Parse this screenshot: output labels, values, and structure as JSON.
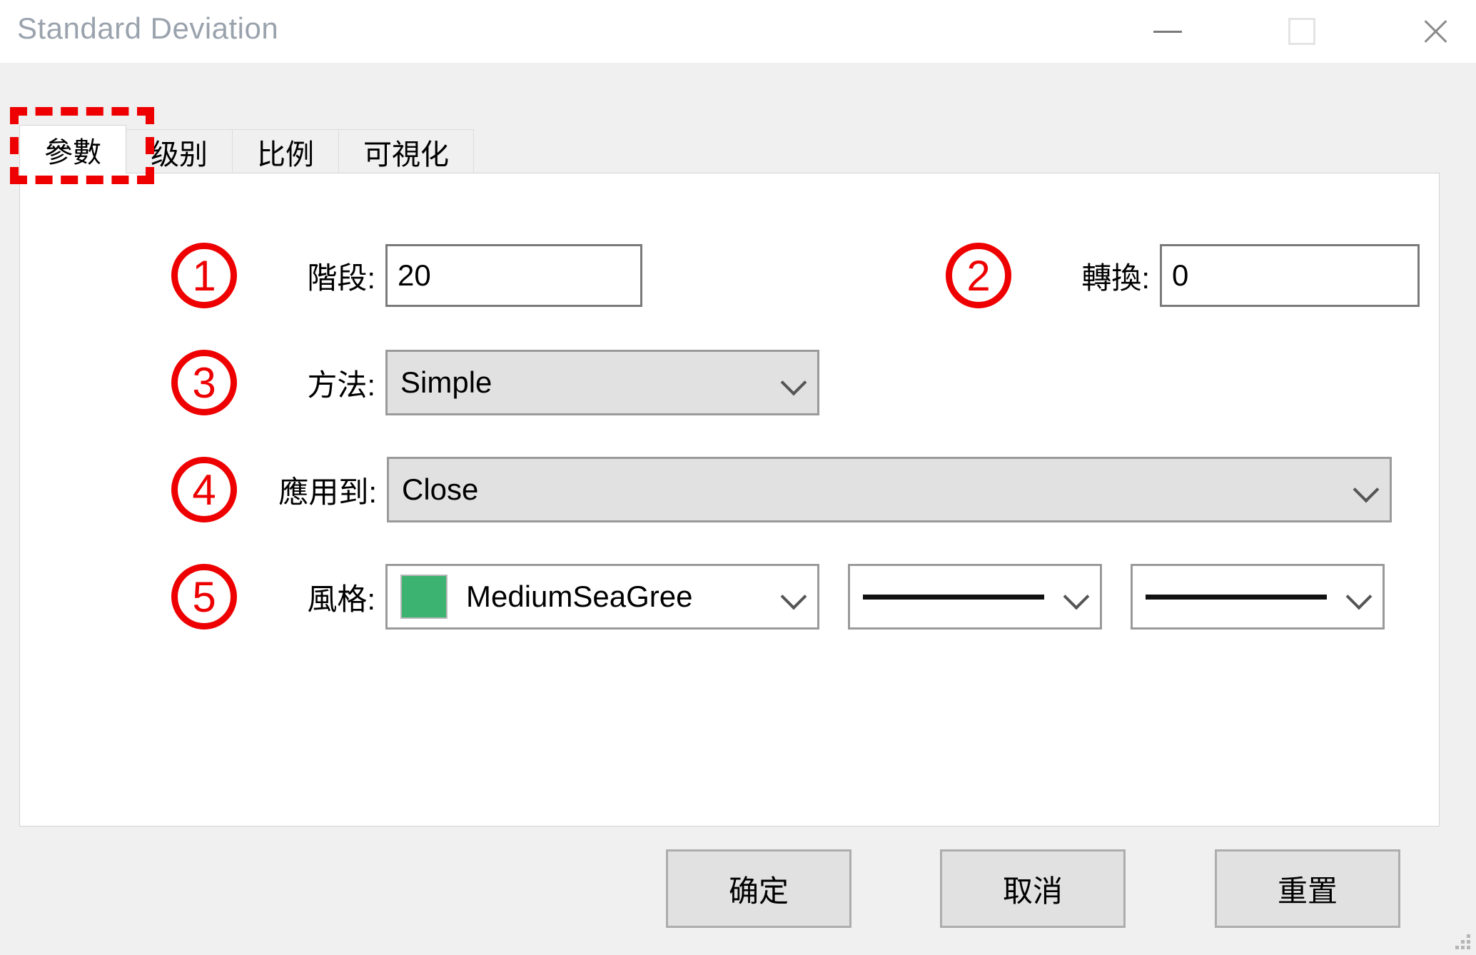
{
  "window": {
    "title": "Standard Deviation",
    "controls": {
      "minimize": "minimize-icon",
      "maximize": "maximize-icon",
      "close": "close-icon"
    }
  },
  "tabs": [
    {
      "label": "參數",
      "active": true
    },
    {
      "label": "级别",
      "active": false
    },
    {
      "label": "比例",
      "active": false
    },
    {
      "label": "可視化",
      "active": false
    }
  ],
  "annotations": {
    "markers": [
      "1",
      "2",
      "3",
      "4",
      "5"
    ],
    "highlight_color": "#EE0000"
  },
  "form": {
    "period": {
      "marker": "1",
      "label": "階段:",
      "value": "20"
    },
    "shift": {
      "marker": "2",
      "label": "轉換:",
      "value": "0"
    },
    "method": {
      "marker": "3",
      "label": "方法:",
      "value": "Simple"
    },
    "apply_to": {
      "marker": "4",
      "label": "應用到:",
      "value": "Close"
    },
    "style": {
      "marker": "5",
      "label": "風格:",
      "color_value": "MediumSeaGree",
      "color_hex": "#3CB371",
      "line_style": "solid",
      "line_width": "solid"
    }
  },
  "footer": {
    "ok": "确定",
    "cancel": "取消",
    "reset": "重置"
  }
}
